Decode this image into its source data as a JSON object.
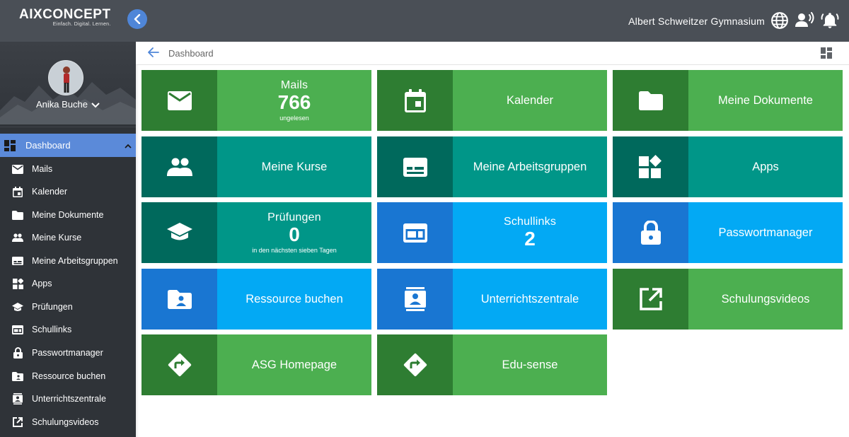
{
  "brand": {
    "name": "AIXCONCEPT",
    "tagline": "Einfach. Digital. Lernen."
  },
  "header": {
    "school": "Albert Schweitzer Gymnasium",
    "icons": [
      "globe-icon",
      "user-voice-icon",
      "bell-icon"
    ]
  },
  "user": {
    "name": "Anika Buche"
  },
  "breadcrumb": {
    "title": "Dashboard"
  },
  "sidebar": {
    "active": {
      "label": "Dashboard",
      "icon": "dashboard-icon"
    },
    "items": [
      {
        "label": "Mails",
        "icon": "mail-icon"
      },
      {
        "label": "Kalender",
        "icon": "calendar-icon"
      },
      {
        "label": "Meine Dokumente",
        "icon": "folder-icon"
      },
      {
        "label": "Meine Kurse",
        "icon": "people-icon"
      },
      {
        "label": "Meine Arbeitsgruppen",
        "icon": "card-icon"
      },
      {
        "label": "Apps",
        "icon": "apps-icon"
      },
      {
        "label": "Prüfungen",
        "icon": "graduation-cap-icon"
      },
      {
        "label": "Schullinks",
        "icon": "links-icon"
      },
      {
        "label": "Passwortmanager",
        "icon": "lock-icon"
      },
      {
        "label": "Ressource buchen",
        "icon": "folder-user-icon"
      },
      {
        "label": "Unterrichtszentrale",
        "icon": "contact-icon"
      },
      {
        "label": "Schulungsvideos",
        "icon": "open-external-icon"
      }
    ]
  },
  "tiles": {
    "mails": {
      "title": "Mails",
      "count": "766",
      "sub": "ungelesen"
    },
    "kalender": {
      "label": "Kalender"
    },
    "dokumente": {
      "label": "Meine Dokumente"
    },
    "kurse": {
      "label": "Meine Kurse"
    },
    "arbeitsgruppen": {
      "label": "Meine Arbeitsgruppen"
    },
    "apps": {
      "label": "Apps"
    },
    "pruefungen": {
      "title": "Prüfungen",
      "count": "0",
      "sub": "in den nächsten sieben Tagen"
    },
    "schullinks": {
      "title": "Schullinks",
      "count": "2"
    },
    "passwort": {
      "label": "Passwortmanager"
    },
    "ressource": {
      "label": "Ressource buchen"
    },
    "unterricht": {
      "label": "Unterrichtszentrale"
    },
    "videos": {
      "label": "Schulungsvideos"
    },
    "asg": {
      "label": "ASG Homepage"
    },
    "edusense": {
      "label": "Edu-sense"
    }
  },
  "colors": {
    "topbar": "#4a4f56",
    "sidebar": "#2f3338",
    "active": "#5b8ad9",
    "green": "#4caf50",
    "green_dark": "#2e7d32",
    "teal": "#009688",
    "teal_dark": "#00695c",
    "blue": "#03a9f4",
    "blue_dark": "#1976d2"
  }
}
